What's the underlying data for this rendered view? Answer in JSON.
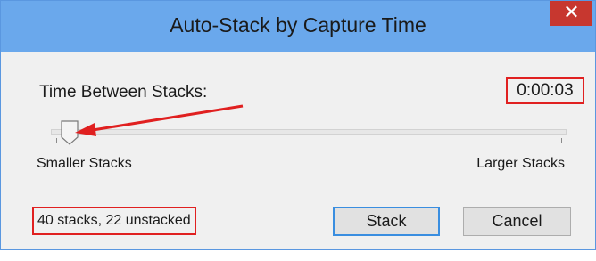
{
  "window": {
    "title": "Auto-Stack by Capture Time",
    "close_glyph": "✕"
  },
  "time_section": {
    "label": "Time Between Stacks:",
    "value": "0:00:03"
  },
  "slider": {
    "min_label": "Smaller Stacks",
    "max_label": "Larger Stacks",
    "position_fraction": 0.04
  },
  "status": {
    "text": "40 stacks, 22 unstacked"
  },
  "buttons": {
    "stack": "Stack",
    "cancel": "Cancel"
  },
  "colors": {
    "titlebar": "#6aa8ec",
    "close": "#c7372f",
    "annotation": "#e02020",
    "focus": "#3a8ee0"
  }
}
